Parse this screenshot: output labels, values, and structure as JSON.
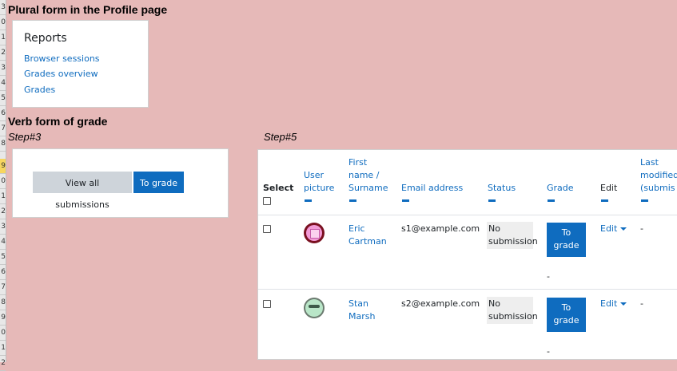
{
  "gutter_numbers": [
    "3",
    "0",
    "1",
    "2",
    "3",
    "4",
    "5",
    "6",
    "7",
    "8",
    "9",
    "0",
    "1",
    "2",
    "3",
    "4",
    "5",
    "6",
    "7",
    "8",
    "9",
    "0",
    "1",
    "2"
  ],
  "plural_section": {
    "heading": "Plural form in the Profile page",
    "card": {
      "title": "Reports",
      "links": [
        "Browser sessions",
        "Grades overview",
        "Grades"
      ]
    }
  },
  "verb_section": {
    "heading": "Verb form of grade",
    "step3": {
      "label": "Step#3",
      "view_all_label": "View all submissions",
      "to_grade_label": "To grade"
    },
    "step5": {
      "label": "Step#5",
      "columns": {
        "select": "Select",
        "user_picture": [
          "User",
          "picture"
        ],
        "name": [
          "First",
          "name /",
          "Surname"
        ],
        "email": "Email address",
        "status": "Status",
        "grade": "Grade",
        "edit": "Edit",
        "last_modified": [
          "Last",
          "modified",
          "(submis"
        ]
      },
      "rows": [
        {
          "first_name": "Eric",
          "surname": "Cartman",
          "email": "s1@example.com",
          "status": [
            "No",
            "submission"
          ],
          "grade_button": [
            "To",
            "grade"
          ],
          "grade_value": "-",
          "edit_label": "Edit",
          "last_modified": "-",
          "avatar_icon": "pink-robot-avatar-icon"
        },
        {
          "first_name": "Stan",
          "surname": "Marsh",
          "email": "s2@example.com",
          "status": [
            "No",
            "submission"
          ],
          "grade_button": [
            "To",
            "grade"
          ],
          "grade_value": "-",
          "edit_label": "Edit",
          "last_modified": "-",
          "avatar_icon": "green-face-avatar-icon"
        }
      ]
    }
  },
  "colors": {
    "background": "#e6b9b8",
    "link": "#0f6cbf",
    "primary_button": "#0f6cbf",
    "secondary_button": "#ced4da"
  }
}
